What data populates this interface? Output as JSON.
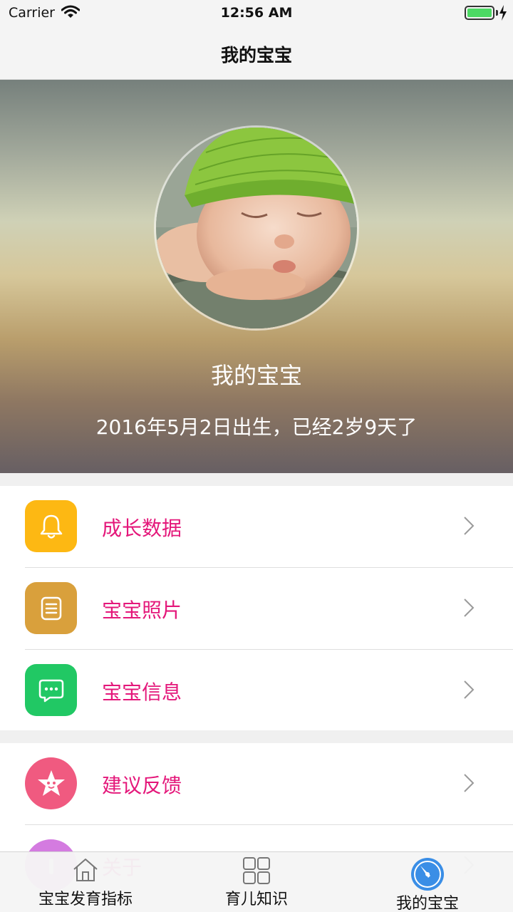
{
  "status_bar": {
    "carrier": "Carrier",
    "time": "12:56 AM",
    "battery_level": 1.0
  },
  "nav": {
    "title": "我的宝宝"
  },
  "hero": {
    "name": "我的宝宝",
    "birth_text": "2016年5月2日出生，已经2岁9天了"
  },
  "menu": {
    "groups": [
      [
        {
          "label": "成长数据",
          "icon": "bell-icon",
          "color": "#fdb813"
        },
        {
          "label": "宝宝照片",
          "icon": "document-icon",
          "color": "#d9a03c"
        },
        {
          "label": "宝宝信息",
          "icon": "message-icon",
          "color": "#21c864"
        }
      ],
      [
        {
          "label": "建议反馈",
          "icon": "star-face-icon",
          "color": "#f05a80"
        },
        {
          "label": "关于",
          "icon": "info-icon",
          "color": "#d47be0"
        }
      ]
    ],
    "label_color": "#e4177a"
  },
  "tabs": [
    {
      "label": "宝宝发育指标",
      "icon": "home-icon",
      "selected": false
    },
    {
      "label": "育儿知识",
      "icon": "grid-icon",
      "selected": false
    },
    {
      "label": "我的宝宝",
      "icon": "compass-icon",
      "selected": true
    }
  ],
  "colors": {
    "accent_tab": "#3a8ee6"
  }
}
